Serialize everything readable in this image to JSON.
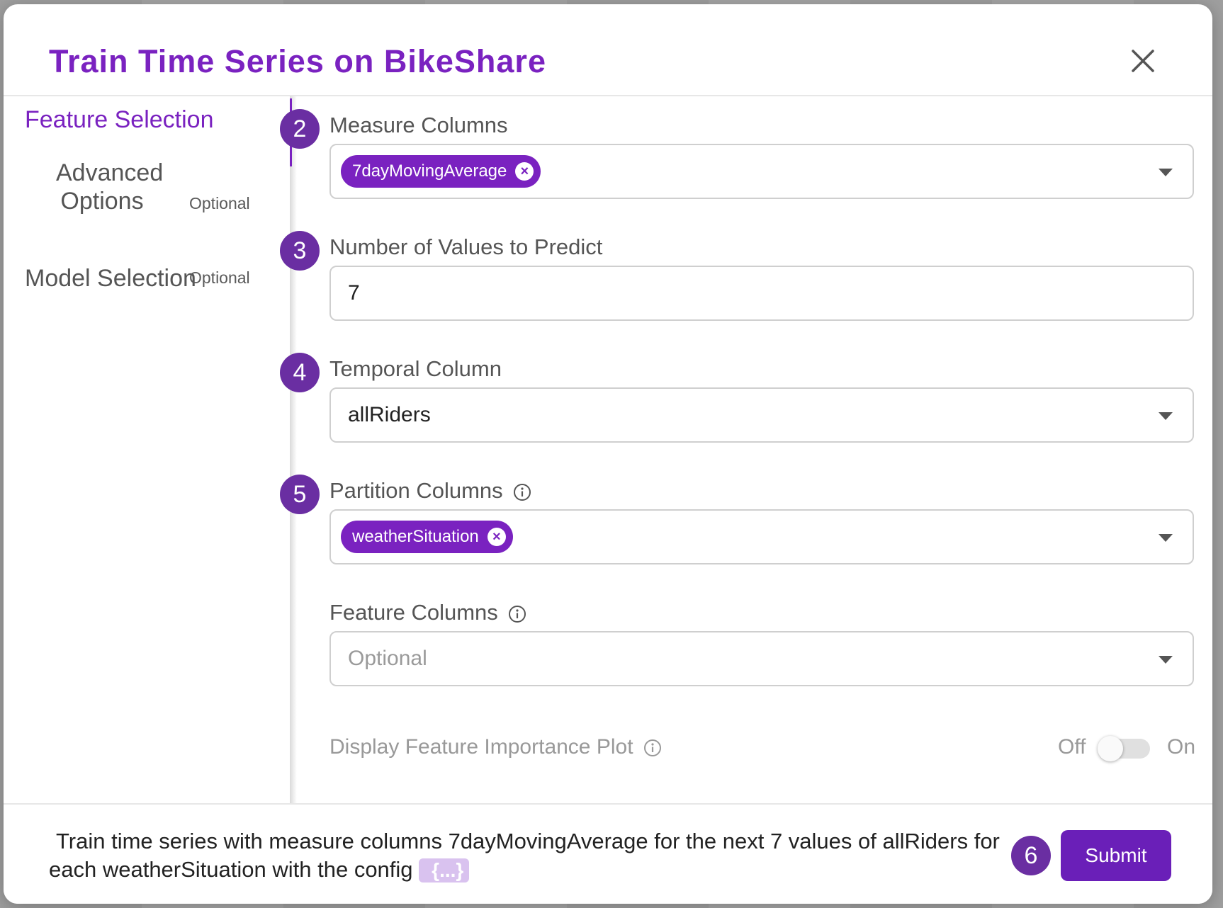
{
  "dialog": {
    "title": "Train Time Series on BikeShare",
    "close_icon": "close-icon"
  },
  "sidebar": {
    "items": [
      {
        "label": "Feature Selection",
        "optional": "",
        "active": true
      },
      {
        "label_line1": "Advanced",
        "label_line2": "Options",
        "optional": "Optional"
      },
      {
        "label": "Model Selection",
        "optional": "Optional"
      }
    ]
  },
  "form": {
    "measure": {
      "badge": "2",
      "label": "Measure Columns",
      "chip": "7dayMovingAverage"
    },
    "predict": {
      "badge": "3",
      "label": "Number of Values to Predict",
      "value": "7"
    },
    "temporal": {
      "badge": "4",
      "label": "Temporal Column",
      "value": "allRiders"
    },
    "partition": {
      "badge": "5",
      "label": "Partition Columns",
      "chip": "weatherSituation"
    },
    "feature": {
      "label": "Feature Columns",
      "placeholder": "Optional"
    },
    "importance": {
      "label": "Display Feature Importance Plot",
      "off_label": "Off",
      "on_label": "On",
      "enabled": false
    }
  },
  "footer": {
    "summary": "Train time series with measure columns 7dayMovingAverage for the next 7 values of allRiders for each weatherSituation with the config",
    "config_chip": "{...}",
    "badge": "6",
    "submit_label": "Submit"
  },
  "colors": {
    "accent": "#7a22c0",
    "badge": "#6a2ea2",
    "submit": "#6a1fb8"
  }
}
